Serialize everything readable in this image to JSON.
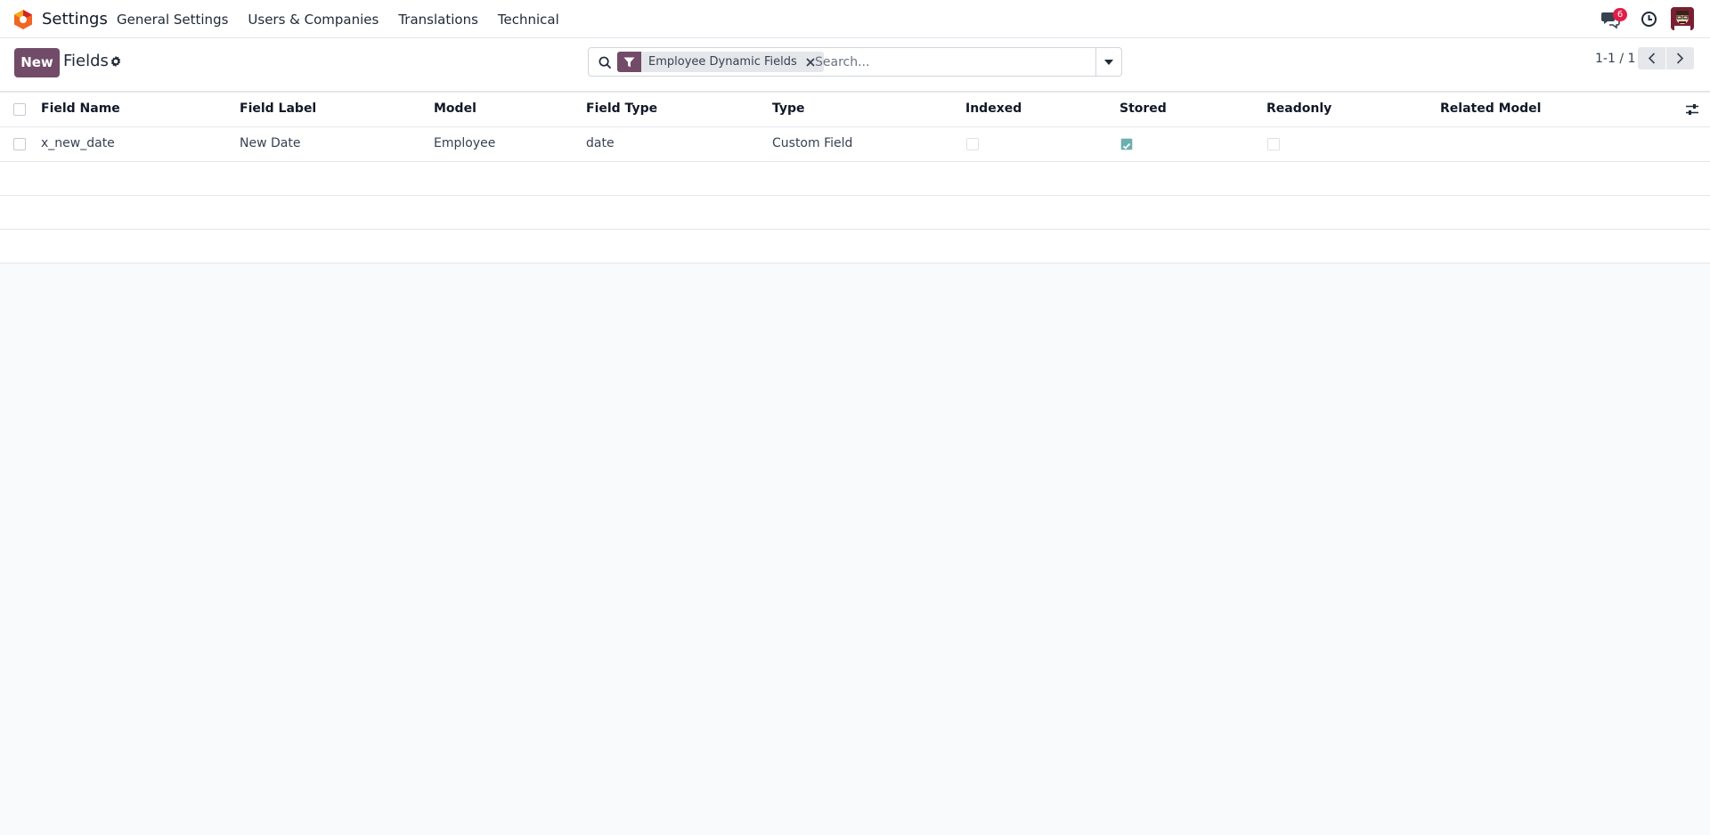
{
  "navbar": {
    "app_name": "Settings",
    "menu": [
      "General Settings",
      "Users & Companies",
      "Translations",
      "Technical"
    ],
    "chat_badge": "6",
    "icons": [
      "odoo-logo-icon",
      "chat-icon",
      "clock-icon",
      "avatar"
    ]
  },
  "control_panel": {
    "new_label": "New",
    "title": "Fields",
    "search": {
      "facet_label": "Employee Dynamic Fields",
      "placeholder": "Search..."
    },
    "pager": "1-1 / 1"
  },
  "list": {
    "columns": [
      "Field Name",
      "Field Label",
      "Model",
      "Field Type",
      "Type",
      "Indexed",
      "Stored",
      "Readonly",
      "Related Model"
    ],
    "rows": [
      {
        "field_name": "x_new_date",
        "field_label": "New Date",
        "model": "Employee",
        "field_type": "date",
        "type": "Custom Field",
        "indexed": false,
        "stored": true,
        "readonly": false,
        "related_model": ""
      }
    ]
  },
  "colors": {
    "primary": "#714b67",
    "badge": "#e11d48",
    "checkbox_checked": "#6ab0b0"
  }
}
